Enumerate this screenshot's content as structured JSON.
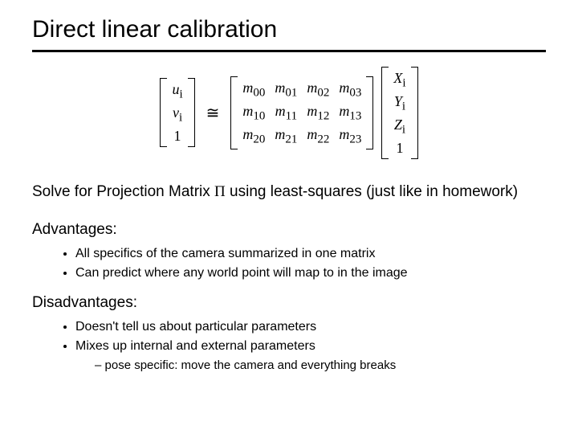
{
  "title": "Direct linear calibration",
  "equation": {
    "u_vec": [
      "u",
      "v",
      "1"
    ],
    "u_sub": "i",
    "rel": "≅",
    "M_rows": [
      [
        "m",
        "m",
        "m",
        "m"
      ],
      [
        "m",
        "m",
        "m",
        "m"
      ],
      [
        "m",
        "m",
        "m",
        "m"
      ]
    ],
    "M_idx": [
      [
        "00",
        "01",
        "02",
        "03"
      ],
      [
        "10",
        "11",
        "12",
        "13"
      ],
      [
        "20",
        "21",
        "22",
        "23"
      ]
    ],
    "X_vec": [
      "X",
      "Y",
      "Z",
      "1"
    ],
    "X_sub": "i"
  },
  "solve_text_pre": "Solve for Projection Matrix ",
  "solve_symbol": "Π",
  "solve_text_post": " using least-squares (just like in homework)",
  "adv_heading": "Advantages:",
  "advantages": [
    "All specifics of the camera summarized in one matrix",
    "Can predict where any world point will map to in the image"
  ],
  "dis_heading": "Disadvantages:",
  "disadvantages": [
    "Doesn't tell us about particular parameters",
    "Mixes up internal and external parameters"
  ],
  "sub_points": [
    "pose specific: move the camera and everything breaks"
  ]
}
